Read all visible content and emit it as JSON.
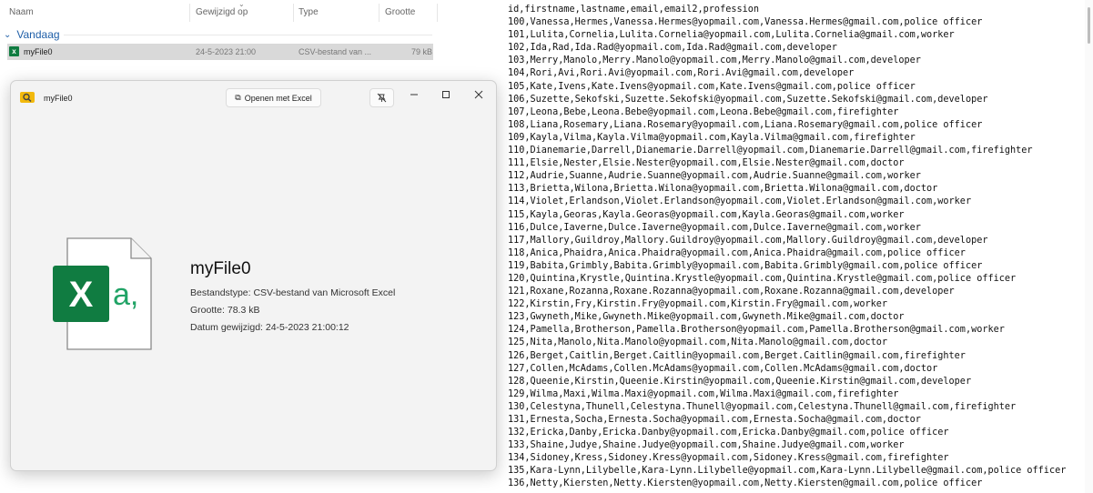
{
  "explorer": {
    "columns": {
      "name": "Naam",
      "modified": "Gewijzigd op",
      "type": "Type",
      "size": "Grootte"
    },
    "group_label": "Vandaag",
    "file": {
      "name": "myFile0",
      "modified": "24-5-2023 21:00",
      "type": "CSV-bestand van ...",
      "size": "79 kB"
    }
  },
  "peek": {
    "window_title": "myFile0",
    "open_button_label": "Openen met Excel",
    "preview_glyph": "a,",
    "file_name": "myFile0",
    "type_line": "Bestandstype: CSV-bestand van Microsoft Excel",
    "size_line": "Grootte: 78.3 kB",
    "date_line": "Datum gewijzigd: 24-5-2023 21:00:12",
    "icons": [
      "search-icon",
      "excel-icon",
      "unpin-icon",
      "minimize-icon",
      "maximize-icon",
      "close-icon"
    ]
  },
  "csv": {
    "lines": [
      "id,firstname,lastname,email,email2,profession",
      "100,Vanessa,Hermes,Vanessa.Hermes@yopmail.com,Vanessa.Hermes@gmail.com,police officer",
      "101,Lulita,Cornelia,Lulita.Cornelia@yopmail.com,Lulita.Cornelia@gmail.com,worker",
      "102,Ida,Rad,Ida.Rad@yopmail.com,Ida.Rad@gmail.com,developer",
      "103,Merry,Manolo,Merry.Manolo@yopmail.com,Merry.Manolo@gmail.com,developer",
      "104,Rori,Avi,Rori.Avi@yopmail.com,Rori.Avi@gmail.com,developer",
      "105,Kate,Ivens,Kate.Ivens@yopmail.com,Kate.Ivens@gmail.com,police officer",
      "106,Suzette,Sekofski,Suzette.Sekofski@yopmail.com,Suzette.Sekofski@gmail.com,developer",
      "107,Leona,Bebe,Leona.Bebe@yopmail.com,Leona.Bebe@gmail.com,firefighter",
      "108,Liana,Rosemary,Liana.Rosemary@yopmail.com,Liana.Rosemary@gmail.com,police officer",
      "109,Kayla,Vilma,Kayla.Vilma@yopmail.com,Kayla.Vilma@gmail.com,firefighter",
      "110,Dianemarie,Darrell,Dianemarie.Darrell@yopmail.com,Dianemarie.Darrell@gmail.com,firefighter",
      "111,Elsie,Nester,Elsie.Nester@yopmail.com,Elsie.Nester@gmail.com,doctor",
      "112,Audrie,Suanne,Audrie.Suanne@yopmail.com,Audrie.Suanne@gmail.com,worker",
      "113,Brietta,Wilona,Brietta.Wilona@yopmail.com,Brietta.Wilona@gmail.com,doctor",
      "114,Violet,Erlandson,Violet.Erlandson@yopmail.com,Violet.Erlandson@gmail.com,worker",
      "115,Kayla,Georas,Kayla.Georas@yopmail.com,Kayla.Georas@gmail.com,worker",
      "116,Dulce,Iaverne,Dulce.Iaverne@yopmail.com,Dulce.Iaverne@gmail.com,worker",
      "117,Mallory,Guildroy,Mallory.Guildroy@yopmail.com,Mallory.Guildroy@gmail.com,developer",
      "118,Anica,Phaidra,Anica.Phaidra@yopmail.com,Anica.Phaidra@gmail.com,police officer",
      "119,Babita,Grimbly,Babita.Grimbly@yopmail.com,Babita.Grimbly@gmail.com,police officer",
      "120,Quintina,Krystle,Quintina.Krystle@yopmail.com,Quintina.Krystle@gmail.com,police officer",
      "121,Roxane,Rozanna,Roxane.Rozanna@yopmail.com,Roxane.Rozanna@gmail.com,developer",
      "122,Kirstin,Fry,Kirstin.Fry@yopmail.com,Kirstin.Fry@gmail.com,worker",
      "123,Gwyneth,Mike,Gwyneth.Mike@yopmail.com,Gwyneth.Mike@gmail.com,doctor",
      "124,Pamella,Brotherson,Pamella.Brotherson@yopmail.com,Pamella.Brotherson@gmail.com,worker",
      "125,Nita,Manolo,Nita.Manolo@yopmail.com,Nita.Manolo@gmail.com,doctor",
      "126,Berget,Caitlin,Berget.Caitlin@yopmail.com,Berget.Caitlin@gmail.com,firefighter",
      "127,Collen,McAdams,Collen.McAdams@yopmail.com,Collen.McAdams@gmail.com,doctor",
      "128,Queenie,Kirstin,Queenie.Kirstin@yopmail.com,Queenie.Kirstin@gmail.com,developer",
      "129,Wilma,Maxi,Wilma.Maxi@yopmail.com,Wilma.Maxi@gmail.com,firefighter",
      "130,Celestyna,Thunell,Celestyna.Thunell@yopmail.com,Celestyna.Thunell@gmail.com,firefighter",
      "131,Ernesta,Socha,Ernesta.Socha@yopmail.com,Ernesta.Socha@gmail.com,doctor",
      "132,Ericka,Danby,Ericka.Danby@yopmail.com,Ericka.Danby@gmail.com,police officer",
      "133,Shaine,Judye,Shaine.Judye@yopmail.com,Shaine.Judye@gmail.com,worker",
      "134,Sidoney,Kress,Sidoney.Kress@yopmail.com,Sidoney.Kress@gmail.com,firefighter",
      "135,Kara-Lynn,Lilybelle,Kara-Lynn.Lilybelle@yopmail.com,Kara-Lynn.Lilybelle@gmail.com,police officer",
      "136,Netty,Kiersten,Netty.Kiersten@yopmail.com,Netty.Kiersten@gmail.com,police officer"
    ]
  },
  "colors": {
    "excel_green": "#107c41",
    "accent": "#1f5fa8",
    "selection": "#d9d9d9"
  }
}
